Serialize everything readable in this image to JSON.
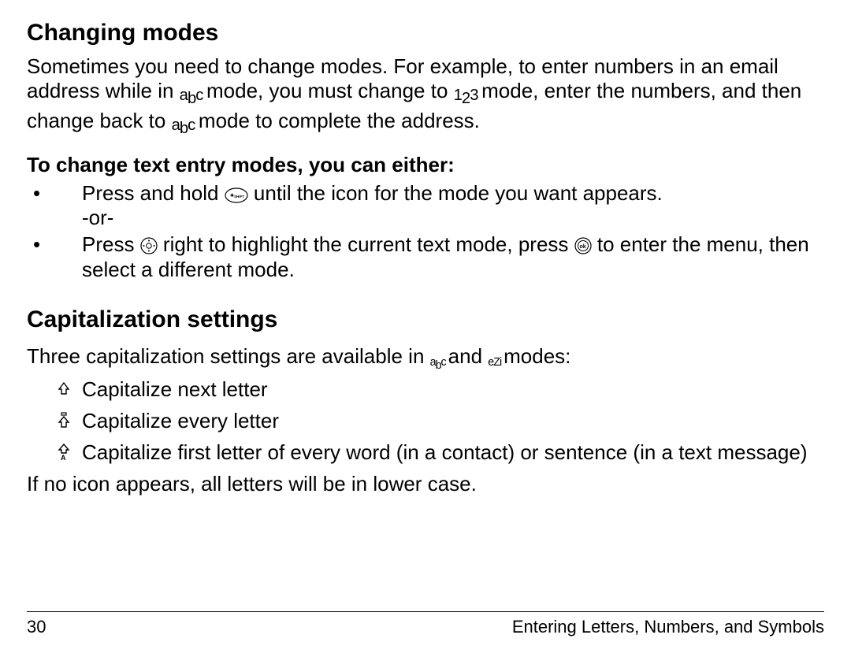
{
  "section1": {
    "heading": "Changing modes",
    "para_frag1": "Sometimes you need to change modes. For example, to enter numbers in an email address while in ",
    "para_frag2": " mode, you must change to ",
    "para_frag3": " mode, enter the numbers, and then change back to ",
    "para_frag4": " mode to complete the address.",
    "sub_heading": "To change text entry modes, you can either:",
    "bullet1_a": "Press and hold ",
    "bullet1_b": " until the icon for the mode you want appears.",
    "bullet1_or": "-or-",
    "bullet2_a": "Press ",
    "bullet2_b": " right to highlight the current text mode, press ",
    "bullet2_c": " to enter the menu, then select a different mode."
  },
  "section2": {
    "heading": "Capitalization settings",
    "para_a": "Three capitalization settings are available in ",
    "para_b": " and ",
    "para_c": " modes:",
    "item1": "Capitalize next letter",
    "item2": "Capitalize every letter",
    "item3": "Capitalize first letter of every word (in a contact) or sentence (in a text message)",
    "closing": "If no icon appears, all letters will be in lower case."
  },
  "inline_modes": {
    "abc_a": "a",
    "abc_b": "b",
    "abc_c": "c",
    "num_1": "1",
    "num_2": "2",
    "num_3": "3",
    "ezi_e": "e",
    "ezi_z": "Z",
    "ezi_i": "i"
  },
  "footer": {
    "page_number": "30",
    "chapter": "Entering Letters, Numbers, and Symbols"
  }
}
